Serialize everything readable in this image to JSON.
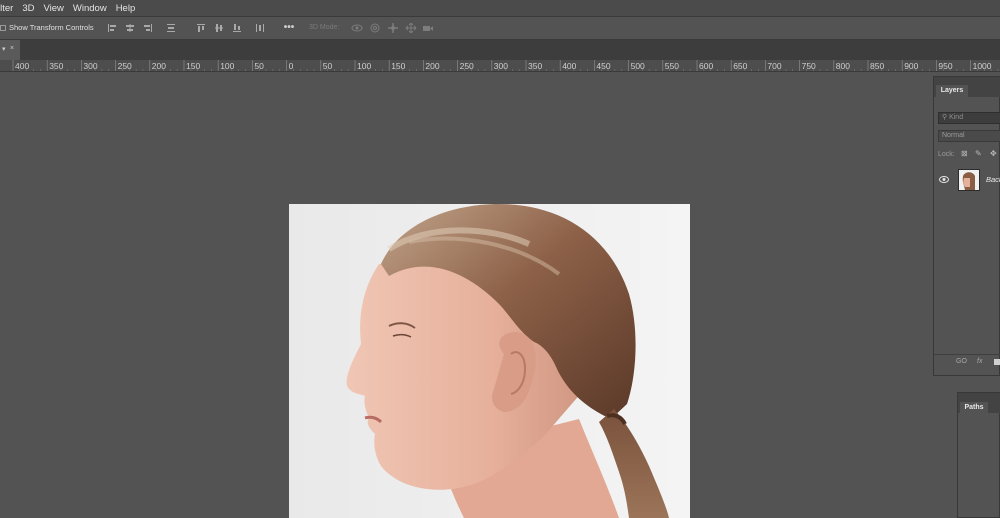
{
  "menubar": {
    "items": [
      {
        "label": "ilter"
      },
      {
        "label": "3D"
      },
      {
        "label": "View"
      },
      {
        "label": "Window"
      },
      {
        "label": "Help"
      }
    ]
  },
  "options": {
    "show_transform_controls_label": "Show Transform Controls",
    "show_transform_controls_checked": false,
    "more_label": "•••",
    "mode_3d_label": "3D Mode:"
  },
  "document_tab": {
    "marker": "▾",
    "close": "×"
  },
  "ruler": {
    "labels": [
      "400",
      "350",
      "300",
      "250",
      "200",
      "150",
      "100",
      "50",
      "0",
      "50",
      "100",
      "150",
      "200",
      "250",
      "300",
      "350",
      "400",
      "450",
      "500",
      "550",
      "600",
      "650",
      "700",
      "750",
      "800",
      "850",
      "900",
      "950",
      "1000"
    ]
  },
  "layers_panel": {
    "tab_label": "Layers",
    "search_placeholder": "Kind",
    "blend_mode": "Normal",
    "lock_label": "Lock:",
    "layer": {
      "name": "Back"
    },
    "bottom": {
      "link": "GO",
      "fx": "fx"
    }
  },
  "paths_panel": {
    "tab_label": "Paths"
  },
  "colors": {
    "workspace": "#535353",
    "menubar": "#4b4b4b",
    "panel": "#535353",
    "image_bg": "#efefef"
  }
}
